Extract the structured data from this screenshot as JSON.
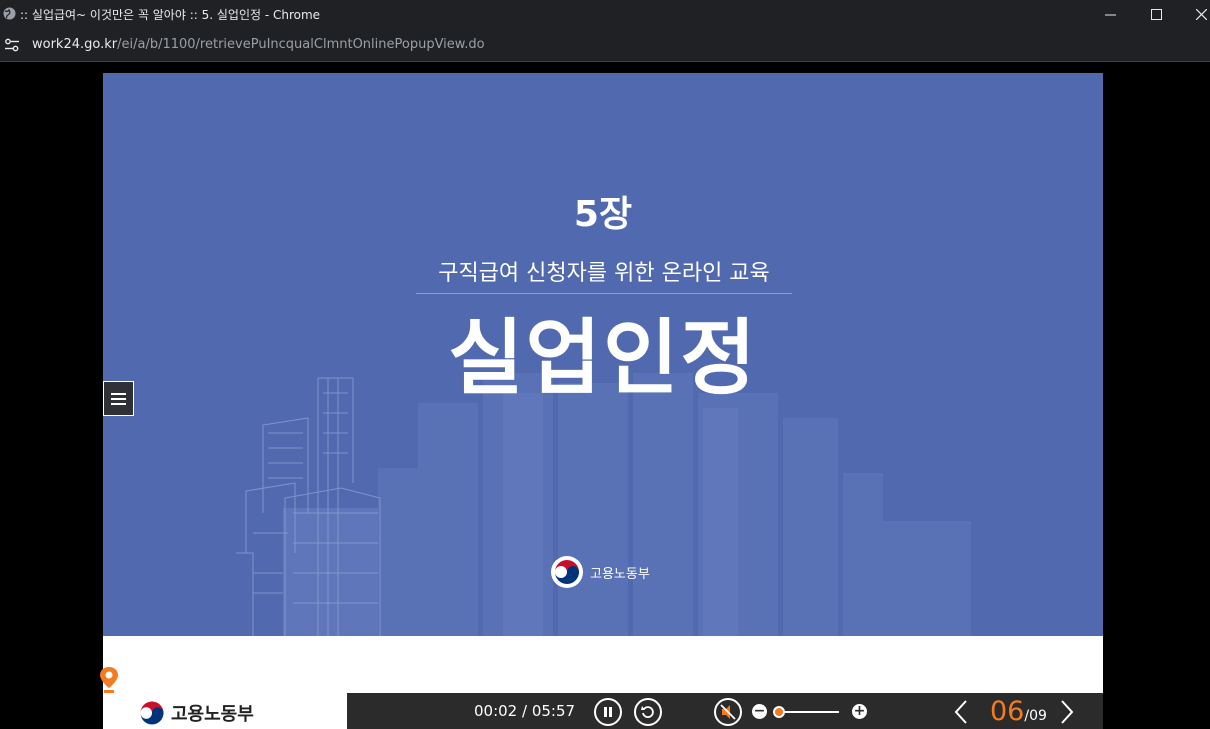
{
  "window": {
    "title": ":: 실업급여~ 이것만은 꼭 알아야 :: 5. 실업인정 - Chrome",
    "icon": "globe-icon"
  },
  "address": {
    "host": "work24.go.kr",
    "path": "/ei/a/b/1100/retrievePuIncqualClmntOnlinePopupView.do"
  },
  "slide": {
    "chapter": "5장",
    "subtitle": "구직급여 신청자를 위한 온라인 교육",
    "title": "실업인정",
    "logo_text": "고용노동부"
  },
  "footer": {
    "logo_text": "고용노동부"
  },
  "player": {
    "current_time": "00:02",
    "separator": " / ",
    "total_time": "05:57",
    "page_current": "06",
    "page_total": "/09",
    "volume_level": 0.1
  },
  "colors": {
    "slide_bg": "#5169ae",
    "accent": "#f47b20",
    "controls_bg": "#2b2b2b"
  }
}
